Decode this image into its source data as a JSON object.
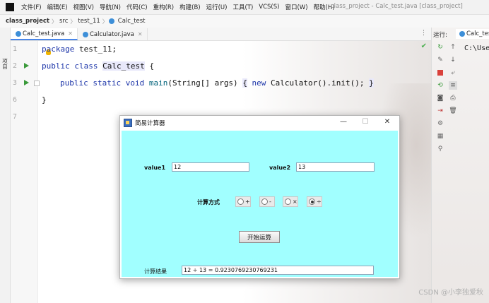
{
  "menubar": {
    "items": [
      "文件(F)",
      "编辑(E)",
      "视图(V)",
      "导航(N)",
      "代码(C)",
      "重构(R)",
      "构建(B)",
      "运行(U)",
      "工具(T)",
      "VCS(S)",
      "窗口(W)",
      "帮助(H)"
    ],
    "window_title": "class_project - Calc_test.java [class_project]"
  },
  "breadcrumb": {
    "project": "class_project",
    "src": "src",
    "package": "test_11",
    "class": "Calc_test"
  },
  "left_strip": {
    "label": "项目"
  },
  "tabs": [
    {
      "label": "Calc_test.java",
      "active": true
    },
    {
      "label": "Calculator.java",
      "active": false
    }
  ],
  "editor": {
    "line_numbers": [
      "1",
      "2",
      "3",
      "6",
      "7"
    ],
    "lines": {
      "l1_kw": "package",
      "l1_rest": " test_11;",
      "l2_kw": "public class",
      "l2_name": "Calc_test",
      "l2_rest": " {",
      "l3_kw": "public static void",
      "l3_fn": "main",
      "l3_args": "(String[] args) ",
      "l3_brace_open": "{",
      "l3_new": " new",
      "l3_call": " Calculator().init(); ",
      "l3_brace_close": "}",
      "l6": "}"
    }
  },
  "run_panel": {
    "header": "运行:",
    "tab_label": "Calc_test",
    "console_text": "C:\\Use"
  },
  "dialog": {
    "title": "简易计算器",
    "value1_label": "value1",
    "value1": "12",
    "value2_label": "value2",
    "value2": "13",
    "mode_label": "计算方式",
    "operators": [
      "+",
      "-",
      "×",
      "÷"
    ],
    "selected_operator": "÷",
    "start_button": "开始运算",
    "result_label": "计算结果",
    "result": "12 ÷ 13 = 0.9230769230769231",
    "content_bg": "#a1ffff"
  },
  "watermark": "CSDN @小李独爱秋"
}
